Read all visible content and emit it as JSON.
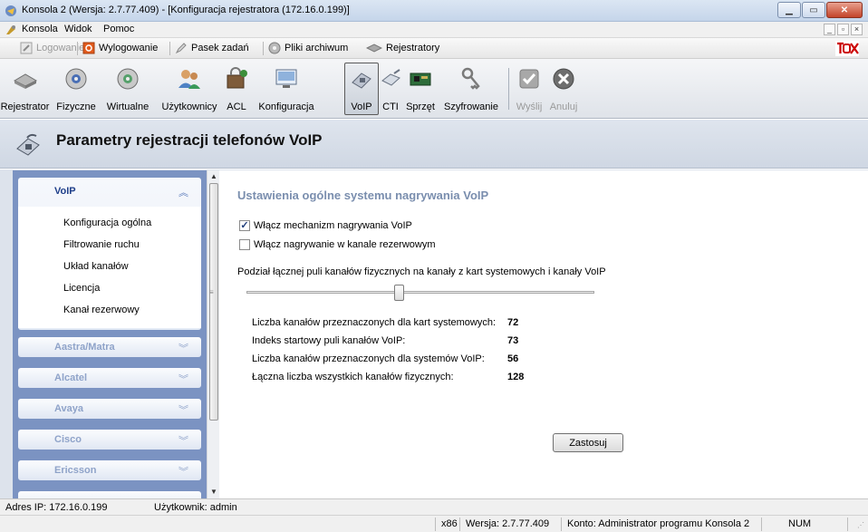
{
  "window": {
    "title": "Konsola 2 (Wersja:  2.7.77.409) - [Konfiguracja rejestratora (172.16.0.199)]"
  },
  "menubar": {
    "items": [
      "Konsola",
      "Widok",
      "Pomoc"
    ]
  },
  "quickbar": {
    "login": "Logowanie",
    "logout": "Wylogowanie",
    "taskbar": "Pasek zadań",
    "archive": "Pliki archiwum",
    "recorders": "Rejestratory"
  },
  "toolbar": {
    "buttons": [
      {
        "label": "Rejestrator",
        "icon": "recorder-icon"
      },
      {
        "label": "Fizyczne",
        "icon": "physical-channels-icon"
      },
      {
        "label": "Wirtualne",
        "icon": "virtual-channels-icon"
      },
      {
        "label": "Użytkownicy",
        "icon": "users-icon"
      },
      {
        "label": "ACL",
        "icon": "acl-icon"
      },
      {
        "label": "Konfiguracja",
        "icon": "configuration-icon"
      },
      {
        "label": "VoIP",
        "icon": "voip-phone-icon"
      },
      {
        "label": "CTI",
        "icon": "cti-icon"
      },
      {
        "label": "Sprzęt",
        "icon": "hardware-icon"
      },
      {
        "label": "Szyfrowanie",
        "icon": "encryption-icon"
      },
      {
        "label": "Wyślij",
        "icon": "send-check-icon"
      },
      {
        "label": "Anuluj",
        "icon": "cancel-x-icon"
      }
    ],
    "active": "VoIP"
  },
  "page": {
    "title": "Parametry rejestracji telefonów VoIP"
  },
  "sidebar": {
    "expanded": {
      "label": "VoIP",
      "items": [
        "Konfiguracja ogólna",
        "Filtrowanie ruchu",
        "Układ kanałów",
        "Licencja",
        "Kanał rezerwowy"
      ]
    },
    "collapsed": [
      "Aastra/Matra",
      "Alcatel",
      "Avaya",
      "Cisco",
      "Ericsson"
    ]
  },
  "main": {
    "section_title": "Ustawienia ogólne systemu nagrywania VoIP",
    "checkboxes": [
      {
        "label": "Włącz mechanizm nagrywania VoIP",
        "checked": true
      },
      {
        "label": "Włącz nagrywanie w kanale rezerwowym",
        "checked": false
      }
    ],
    "slider_description": "Podział łącznej puli kanałów fizycznych na kanały z kart systemowych i kanały VoIP",
    "slider_value_fraction": 0.44,
    "stats": [
      {
        "label": "Liczba kanałów przeznaczonych dla kart systemowych:",
        "value": "72"
      },
      {
        "label": "Indeks startowy puli kanałów VoIP:",
        "value": "73"
      },
      {
        "label": "Liczba kanałów przeznaczonych dla systemów VoIP:",
        "value": "56"
      },
      {
        "label": "Łączna liczba wszystkich kanałów fizycznych:",
        "value": "128"
      }
    ],
    "apply_label": "Zastosuj"
  },
  "status": {
    "ip": "Adres IP: 172.16.0.199",
    "user": "Użytkownik: admin",
    "arch": "x86",
    "version": "Wersja: 2.7.77.409",
    "account": "Konto: Administrator programu Konsola 2",
    "num": "NUM"
  },
  "colors": {
    "sidebar_bg": "#7b93c2",
    "section_title": "#7a8eae",
    "brand_red": "#cc0000"
  }
}
